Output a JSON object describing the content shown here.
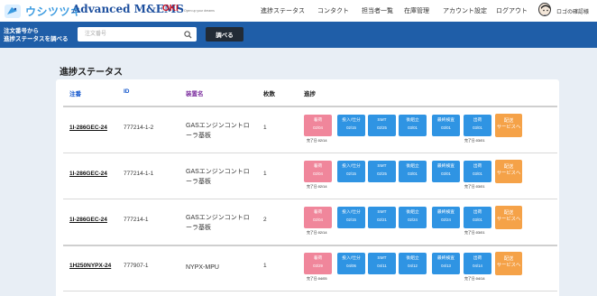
{
  "header": {
    "logo_jp": "ウシツツキ",
    "logo_brand": "Advanced M&EMS",
    "logo_oki": "OKI",
    "logo_oki_sub": "Open up your dreams",
    "nav": [
      "進捗ステータス",
      "コンタクト",
      "担当者一覧",
      "在庫管理",
      "アカウント設定",
      "ログアウト"
    ],
    "user_name": "ロゴの確認様"
  },
  "search": {
    "label_line1": "注文番号から",
    "label_line2": "進捗ステータスを調べる",
    "placeholder": "注文番号",
    "button": "調べる"
  },
  "page_title": "進捗ステータス",
  "columns": {
    "order": "注番",
    "id": "ID",
    "name": "装置名",
    "qty": "枚数",
    "progress": "進捗"
  },
  "colors": {
    "step_pink": "#f0869b",
    "step_blue": "#2f94e3",
    "step_orange": "#f5a248",
    "header_blue": "#1f5ea8",
    "col_header_order": "#1155cc",
    "col_header_id": "#1155cc",
    "col_header_name": "#7b2d9e"
  },
  "rows": [
    {
      "order": "1I-286GEC-24",
      "id": "777214-1-2",
      "name_line1": "GASエンジンコントロ",
      "name_line2": "ーラ基板",
      "qty": "1",
      "steps": [
        {
          "label": "着荷",
          "date": "02/04"
        },
        {
          "label": "投入/仕分",
          "date": "02/15"
        },
        {
          "label": "SMT",
          "date": "02/25"
        },
        {
          "label": "後組立",
          "date": "03/01"
        },
        {
          "label": "最終検査",
          "date": "03/01"
        },
        {
          "label": "出荷",
          "date": "03/01"
        }
      ],
      "delivery_l1": "配送",
      "delivery_l2": "サービスへ",
      "done_first": "完了日:02/14",
      "done_last": "完了日:03/01"
    },
    {
      "order": "1I-286GEC-24",
      "id": "777214-1-1",
      "name_line1": "GASエンジンコントロ",
      "name_line2": "ーラ基板",
      "qty": "1",
      "steps": [
        {
          "label": "着荷",
          "date": "02/04"
        },
        {
          "label": "投入/仕分",
          "date": "02/15"
        },
        {
          "label": "SMT",
          "date": "02/25"
        },
        {
          "label": "後組立",
          "date": "03/01"
        },
        {
          "label": "最終検査",
          "date": "03/01"
        },
        {
          "label": "出荷",
          "date": "03/01"
        }
      ],
      "delivery_l1": "配送",
      "delivery_l2": "サービスへ",
      "done_first": "完了日:02/14",
      "done_last": "完了日:03/01"
    },
    {
      "order": "1I-286GEC-24",
      "id": "777214-1",
      "name_line1": "GASエンジンコントロ",
      "name_line2": "ーラ基板",
      "qty": "2",
      "steps": [
        {
          "label": "着荷",
          "date": "02/04"
        },
        {
          "label": "投入/仕分",
          "date": "02/15"
        },
        {
          "label": "SMT",
          "date": "02/21"
        },
        {
          "label": "後組立",
          "date": "02/24"
        },
        {
          "label": "最終検査",
          "date": "02/24"
        },
        {
          "label": "出荷",
          "date": "03/01"
        }
      ],
      "delivery_l1": "配送",
      "delivery_l2": "サービスへ",
      "done_first": "完了日:02/14",
      "done_last": "完了日:03/01"
    },
    {
      "order": "1H250NYPX-24",
      "id": "777907-1",
      "name_line1": "NYPX-MPU",
      "name_line2": "",
      "qty": "1",
      "steps": [
        {
          "label": "着荷",
          "date": "03/29"
        },
        {
          "label": "投入/仕分",
          "date": "04/06"
        },
        {
          "label": "SMT",
          "date": "04/11"
        },
        {
          "label": "後組立",
          "date": "04/12"
        },
        {
          "label": "最終検査",
          "date": "04/13"
        },
        {
          "label": "出荷",
          "date": "04/14"
        }
      ],
      "delivery_l1": "配送",
      "delivery_l2": "サービスへ",
      "done_first": "完了日:04/05",
      "done_last": "完了日:04/14"
    }
  ]
}
